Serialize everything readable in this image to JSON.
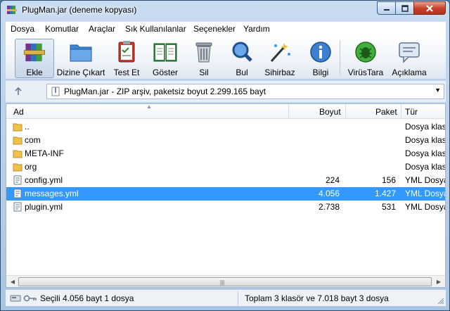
{
  "window": {
    "title": "PlugMan.jar (deneme kopyası)"
  },
  "menu": [
    "Dosya",
    "Komutlar",
    "Araçlar",
    "Sık Kullanılanlar",
    "Seçenekler",
    "Yardım"
  ],
  "toolbar": [
    {
      "label": "Ekle",
      "icon": "archive-books-icon"
    },
    {
      "label": "Dizine Çıkart",
      "icon": "folder-extract-icon"
    },
    {
      "label": "Test Et",
      "icon": "clipboard-check-icon"
    },
    {
      "label": "Göster",
      "icon": "open-book-icon"
    },
    {
      "label": "Sil",
      "icon": "trash-can-icon"
    },
    {
      "label": "Bul",
      "icon": "magnifier-icon"
    },
    {
      "label": "Sihirbaz",
      "icon": "magic-wand-icon"
    },
    {
      "label": "Bilgi",
      "icon": "info-icon"
    },
    {
      "label": "VirüsTara",
      "icon": "virus-bug-icon"
    },
    {
      "label": "Açıklama",
      "icon": "comment-bubble-icon"
    }
  ],
  "address": {
    "text": "PlugMan.jar - ZIP arşiv, paketsiz boyut 2.299.165 bayt"
  },
  "columns": {
    "name": "Ad",
    "size": "Boyut",
    "packed": "Paket",
    "type": "Tür"
  },
  "files": [
    {
      "name": "..",
      "size": "",
      "packed": "",
      "type": "Dosya klasörü",
      "kind": "folder"
    },
    {
      "name": "com",
      "size": "",
      "packed": "",
      "type": "Dosya klasörü",
      "kind": "folder"
    },
    {
      "name": "META-INF",
      "size": "",
      "packed": "",
      "type": "Dosya klasörü",
      "kind": "folder"
    },
    {
      "name": "org",
      "size": "",
      "packed": "",
      "type": "Dosya klasörü",
      "kind": "folder"
    },
    {
      "name": "config.yml",
      "size": "224",
      "packed": "156",
      "type": "YML Dosyası",
      "kind": "file"
    },
    {
      "name": "messages.yml",
      "size": "4.056",
      "packed": "1.427",
      "type": "YML Dosyası",
      "kind": "file",
      "selected": true
    },
    {
      "name": "plugin.yml",
      "size": "2.738",
      "packed": "531",
      "type": "YML Dosyası",
      "kind": "file"
    }
  ],
  "status": {
    "left": "Seçili 4.056 bayt 1 dosya",
    "right": "Toplam 3 klasör ve 7.018 bayt 3 dosya"
  },
  "colors": {
    "selection": "#3399ff",
    "folder": "#f0c24a",
    "close_button": "#c8452c"
  }
}
